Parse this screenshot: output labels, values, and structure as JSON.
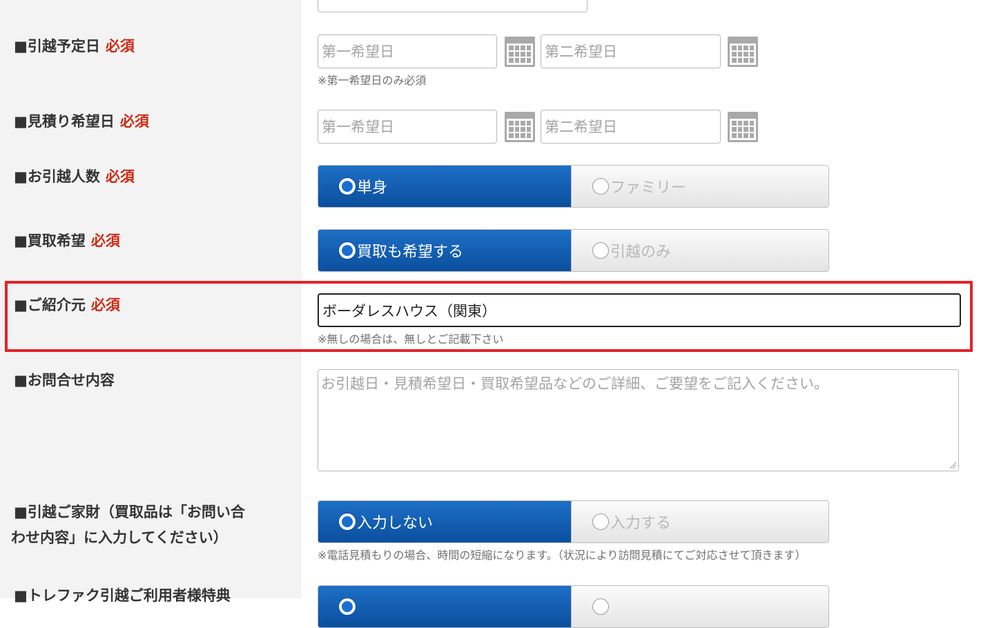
{
  "rows": {
    "move_date": {
      "label": "■引越予定日",
      "required": "必須",
      "first_placeholder": "第一希望日",
      "second_placeholder": "第二希望日",
      "note": "※第一希望日のみ必須"
    },
    "estimate_date": {
      "label": "■見積り希望日",
      "required": "必須",
      "first_placeholder": "第一希望日",
      "second_placeholder": "第二希望日"
    },
    "household": {
      "label": "■お引越人数",
      "required": "必須",
      "options": [
        "単身",
        "ファミリー"
      ],
      "selected": "単身"
    },
    "buyback": {
      "label": "■買取希望",
      "required": "必須",
      "options": [
        "買取も希望する",
        "引越のみ"
      ],
      "selected": "買取も希望する"
    },
    "referral": {
      "label": "■ご紹介元",
      "required": "必須",
      "value": "ボーダレスハウス（関東）",
      "note": "※無しの場合は、無しとご記載下さい"
    },
    "inquiry": {
      "label": "■お問合せ内容",
      "placeholder": "お引越日・見積希望日・買取希望品などのご詳細、ご要望をご記入ください。"
    },
    "furniture": {
      "label_line1": "■引越ご家財（買取品は「お問い合",
      "label_line2": "わせ内容」に入力してください）",
      "options": [
        "入力しない",
        "入力する"
      ],
      "selected": "入力しない",
      "note": "※電話見積もりの場合、時間の短縮になります。（状況により訪問見積にてご対応させて頂きます）"
    },
    "benefit": {
      "label": "■トレファク引越ご利用者様特典"
    }
  },
  "colors": {
    "required_red": "#cc2a14",
    "selected_blue": "#0b4f9e",
    "highlight_red": "#e3222a",
    "label_bg": "#f3f3f3"
  },
  "icons": {
    "calendar": "calendar-icon",
    "radio_on": "radio-selected-icon",
    "radio_off": "radio-unselected-icon"
  }
}
